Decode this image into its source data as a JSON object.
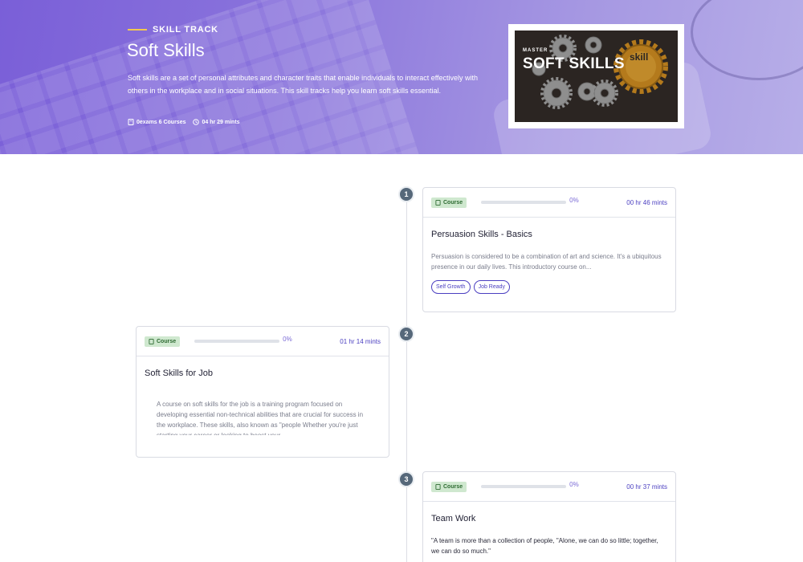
{
  "hero": {
    "eyebrow": "SKILL TRACK",
    "title": "Soft Skills",
    "description": "Soft skills are a set of personal attributes and character traits that enable individuals to interact effectively with others in the workplace and in social situations. This skill tracks help you learn soft skills essential.",
    "meta_courses": "0exams 6 Courses",
    "meta_duration": "04 hr 29 mints",
    "image": {
      "master": "MASTER",
      "headline": "SOFT SKILLS",
      "gear_label": "skill"
    }
  },
  "courses": [
    {
      "step": "1",
      "badge": "Course",
      "progress_percent": 0,
      "progress_label": "0%",
      "duration": "00 hr 46 mints",
      "title": "Persuasion Skills - Basics",
      "description": "Persuasion is considered to be a combination of art and science. It's a ubiquitous presence in our daily lives. This introductory course on...",
      "tags": [
        "Self Growth",
        "Job Ready"
      ]
    },
    {
      "step": "2",
      "badge": "Course",
      "progress_percent": 0,
      "progress_label": "0%",
      "duration": "01 hr 14 mints",
      "title": "Soft Skills for Job",
      "description": "A course on soft skills for the job is a training program focused on developing essential non-technical abilities that are crucial for success in the workplace. These skills, also known as \"people Whether you're just starting your career or looking to boost your"
    },
    {
      "step": "3",
      "badge": "Course",
      "progress_percent": 0,
      "progress_label": "0%",
      "duration": "00 hr 37 mints",
      "title": "Team Work",
      "description": "\"A team is more than a collection of people, \"Alone, we can do so little; together, we can do so much.\""
    }
  ],
  "colors": {
    "hero_start": "#7a5fd8",
    "hero_end": "#b7aee8",
    "accent": "#4b3fc1",
    "badge_bg": "#cfe8cf",
    "step_circle": "#56687a"
  }
}
